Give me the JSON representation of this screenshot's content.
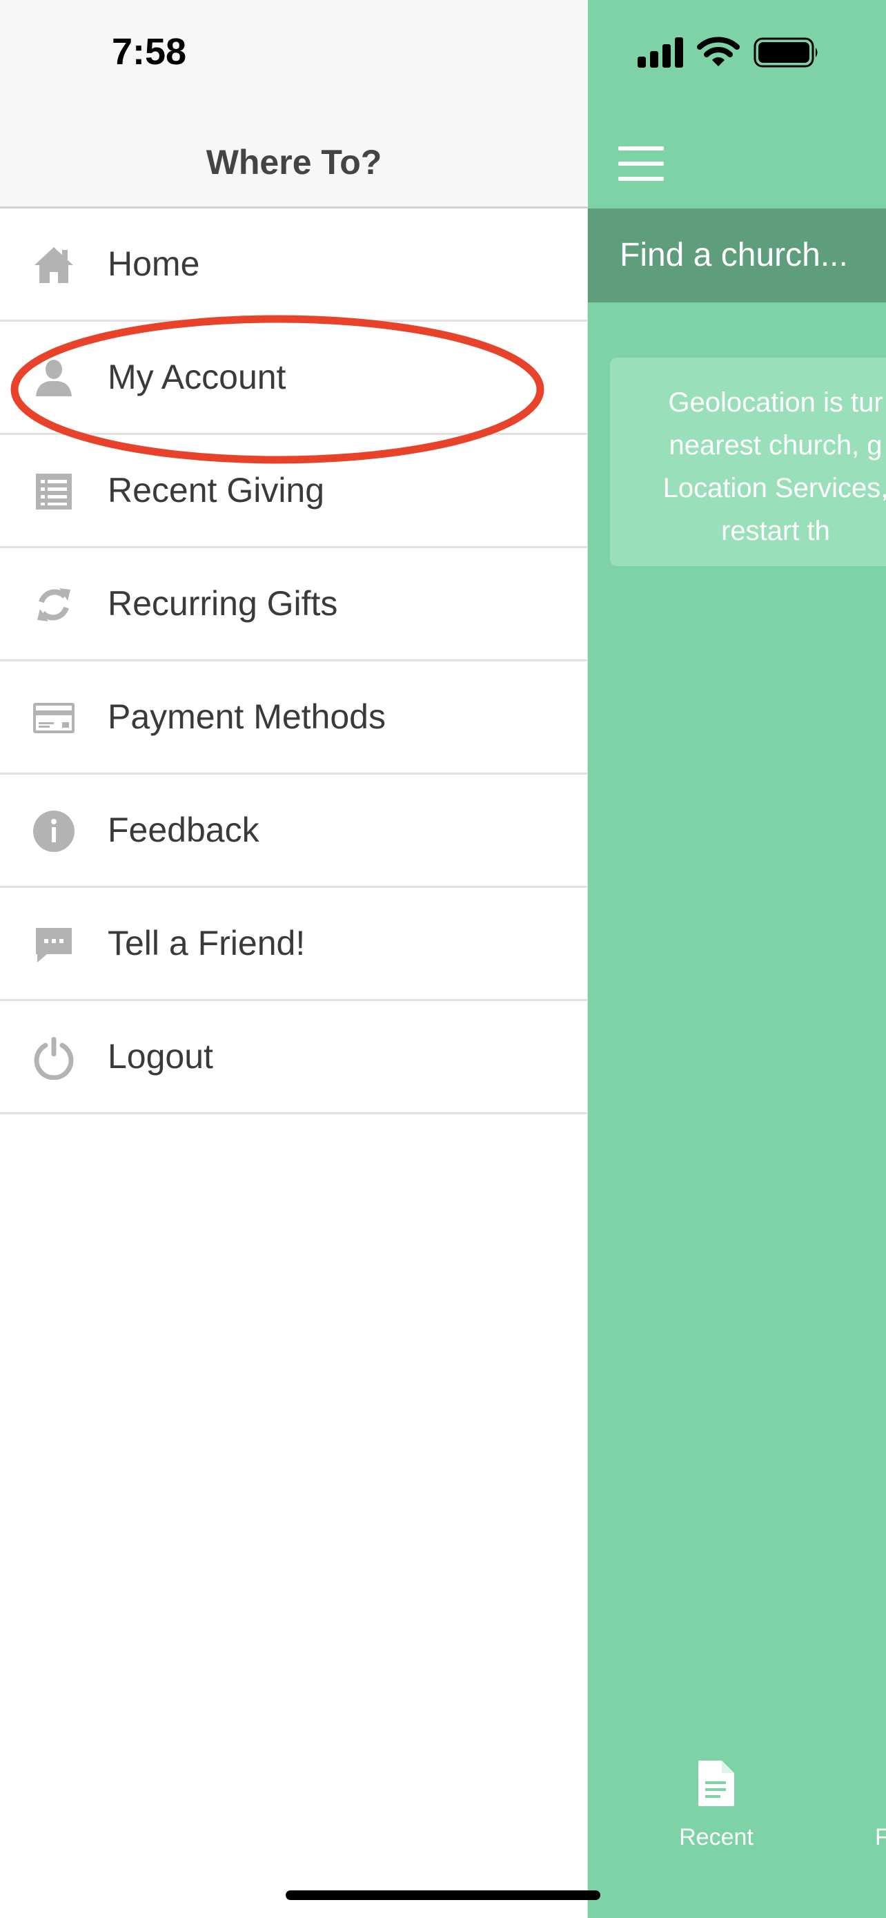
{
  "status_bar": {
    "time": "7:58"
  },
  "drawer": {
    "title": "Where To?",
    "items": [
      {
        "label": "Home",
        "icon": "home-icon"
      },
      {
        "label": "My Account",
        "icon": "user-icon"
      },
      {
        "label": "Recent Giving",
        "icon": "list-icon"
      },
      {
        "label": "Recurring Gifts",
        "icon": "refresh-icon"
      },
      {
        "label": "Payment Methods",
        "icon": "credit-card-icon"
      },
      {
        "label": "Feedback",
        "icon": "info-icon"
      },
      {
        "label": "Tell a Friend!",
        "icon": "chat-icon"
      },
      {
        "label": "Logout",
        "icon": "power-icon"
      }
    ]
  },
  "main": {
    "search_placeholder": "Find a church...",
    "geolocation_message": "Geolocation is tur\nnearest church, g\nLocation Services,\nrestart th",
    "tabs": [
      {
        "label": "Recent",
        "icon": "document-icon"
      },
      {
        "label": "F"
      }
    ]
  },
  "colors": {
    "main_background": "#7ed3a6",
    "search_bar": "#5f9e7d",
    "message_box": "#99dfba",
    "highlight_annotation": "#e8432a",
    "menu_icon": "#b3b3b3"
  }
}
